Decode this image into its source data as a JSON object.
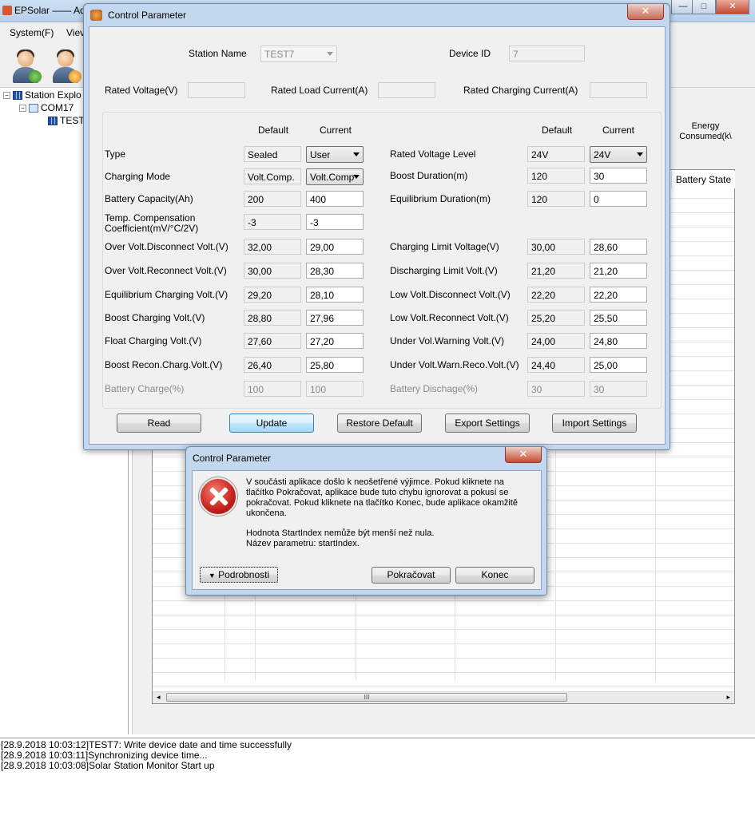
{
  "main_window": {
    "title": "EPSolar —— Ad",
    "min_glyph": "—",
    "max_glyph": "□",
    "close_glyph": "✕"
  },
  "menu": {
    "system": "System(F)",
    "view": "Viev"
  },
  "tree": {
    "root": "Station Explo",
    "com": "COM17",
    "station": "TEST"
  },
  "grid": {
    "energy_consumed": "Energy Consumed(k\\",
    "battery_state": "Battery State",
    "scroll_glyph": "III"
  },
  "log": [
    "[28.9.2018 10:03:12]TEST7: Write device date and time successfully",
    "[28.9.2018 10:03:11]Synchronizing device time...",
    "[28.9.2018 10:03:08]Solar Station Monitor Start up"
  ],
  "control_parameter": {
    "title": "Control Parameter",
    "close_glyph": "✕",
    "station_name_label": "Station Name",
    "station_name_value": "TEST7",
    "device_id_label": "Device ID",
    "device_id_value": "7",
    "rated_voltage_label": "Rated Voltage(V)",
    "rated_load_current_label": "Rated Load Current(A)",
    "rated_charging_current_label": "Rated Charging Current(A)",
    "col_default": "Default",
    "col_current": "Current",
    "left": {
      "type_label": "Type",
      "type_default": "Sealed",
      "type_current": "User",
      "charging_mode_label": "Charging Mode",
      "charging_mode_default": "Volt.Comp.",
      "charging_mode_current": "Volt.Comp",
      "battery_capacity_label": "Battery Capacity(Ah)",
      "battery_capacity_default": "200",
      "battery_capacity_current": "400",
      "temp_comp_label_1": "Temp. Compensation",
      "temp_comp_label_2": "Coefficient(mV/°C/2V)",
      "temp_comp_default": "-3",
      "temp_comp_current": "-3",
      "over_volt_disc_label": "Over Volt.Disconnect Volt.(V)",
      "over_volt_disc_default": "32,00",
      "over_volt_disc_current": "29,00",
      "over_volt_reconn_label": "Over Volt.Reconnect Volt.(V)",
      "over_volt_reconn_default": "30,00",
      "over_volt_reconn_current": "28,30",
      "equil_charging_label": "Equilibrium Charging Volt.(V)",
      "equil_charging_default": "29,20",
      "equil_charging_current": "28,10",
      "boost_charging_label": "Boost Charging Volt.(V)",
      "boost_charging_default": "28,80",
      "boost_charging_current": "27,96",
      "float_charging_label": "Float Charging Volt.(V)",
      "float_charging_default": "27,60",
      "float_charging_current": "27,20",
      "boost_recon_label": "Boost Recon.Charg.Volt.(V)",
      "boost_recon_default": "26,40",
      "boost_recon_current": "25,80",
      "battery_charge_label": "Battery Charge(%)",
      "battery_charge_default": "100",
      "battery_charge_current": "100"
    },
    "right": {
      "rated_voltage_level_label": "Rated Voltage Level",
      "rated_voltage_level_default": "24V",
      "rated_voltage_level_current": "24V",
      "boost_duration_label": "Boost Duration(m)",
      "boost_duration_default": "120",
      "boost_duration_current": "30",
      "equil_duration_label": "Equilibrium Duration(m)",
      "equil_duration_default": "120",
      "equil_duration_current": "0",
      "charging_limit_label": "Charging Limit Voltage(V)",
      "charging_limit_default": "30,00",
      "charging_limit_current": "28,60",
      "discharging_limit_label": "Discharging Limit Volt.(V)",
      "discharging_limit_default": "21,20",
      "discharging_limit_current": "21,20",
      "low_volt_disc_label": "Low Volt.Disconnect Volt.(V)",
      "low_volt_disc_default": "22,20",
      "low_volt_disc_current": "22,20",
      "low_volt_reconn_label": "Low Volt.Reconnect Volt.(V)",
      "low_volt_reconn_default": "25,20",
      "low_volt_reconn_current": "25,50",
      "under_vol_warn_label": "Under Vol.Warning Volt.(V)",
      "under_vol_warn_default": "24,00",
      "under_vol_warn_current": "24,80",
      "under_volt_warn_reco_label": "Under Volt.Warn.Reco.Volt.(V)",
      "under_volt_warn_reco_default": "24,40",
      "under_volt_warn_reco_current": "25,00",
      "battery_discharge_label": "Battery Dischage(%)",
      "battery_discharge_default": "30",
      "battery_discharge_current": "30"
    },
    "buttons": {
      "read": "Read",
      "update": "Update",
      "restore_default": "Restore Default",
      "export_settings": "Export Settings",
      "import_settings": "Import Settings"
    }
  },
  "error_dialog": {
    "title": "Control Parameter",
    "close_glyph": "✕",
    "message_lines": [
      "V součásti aplikace došlo k neošetřené výjimce. Pokud kliknete na",
      "tlačítko Pokračovat, aplikace bude tuto chybu ignorovat a pokusí se",
      "pokračovat. Pokud kliknete na tlačítko Konec, bude aplikace okamžitě",
      "ukončena."
    ],
    "detail_lines": [
      "Hodnota StartIndex nemůže být menší než nula.",
      "Název parametru: startIndex."
    ],
    "details_button": "Podrobnosti",
    "continue_button": "Pokračovat",
    "quit_button": "Konec"
  },
  "colors": {
    "window_frame": "#c3d7ef",
    "close_red": "#c54a31",
    "error_red": "#c4211a"
  }
}
